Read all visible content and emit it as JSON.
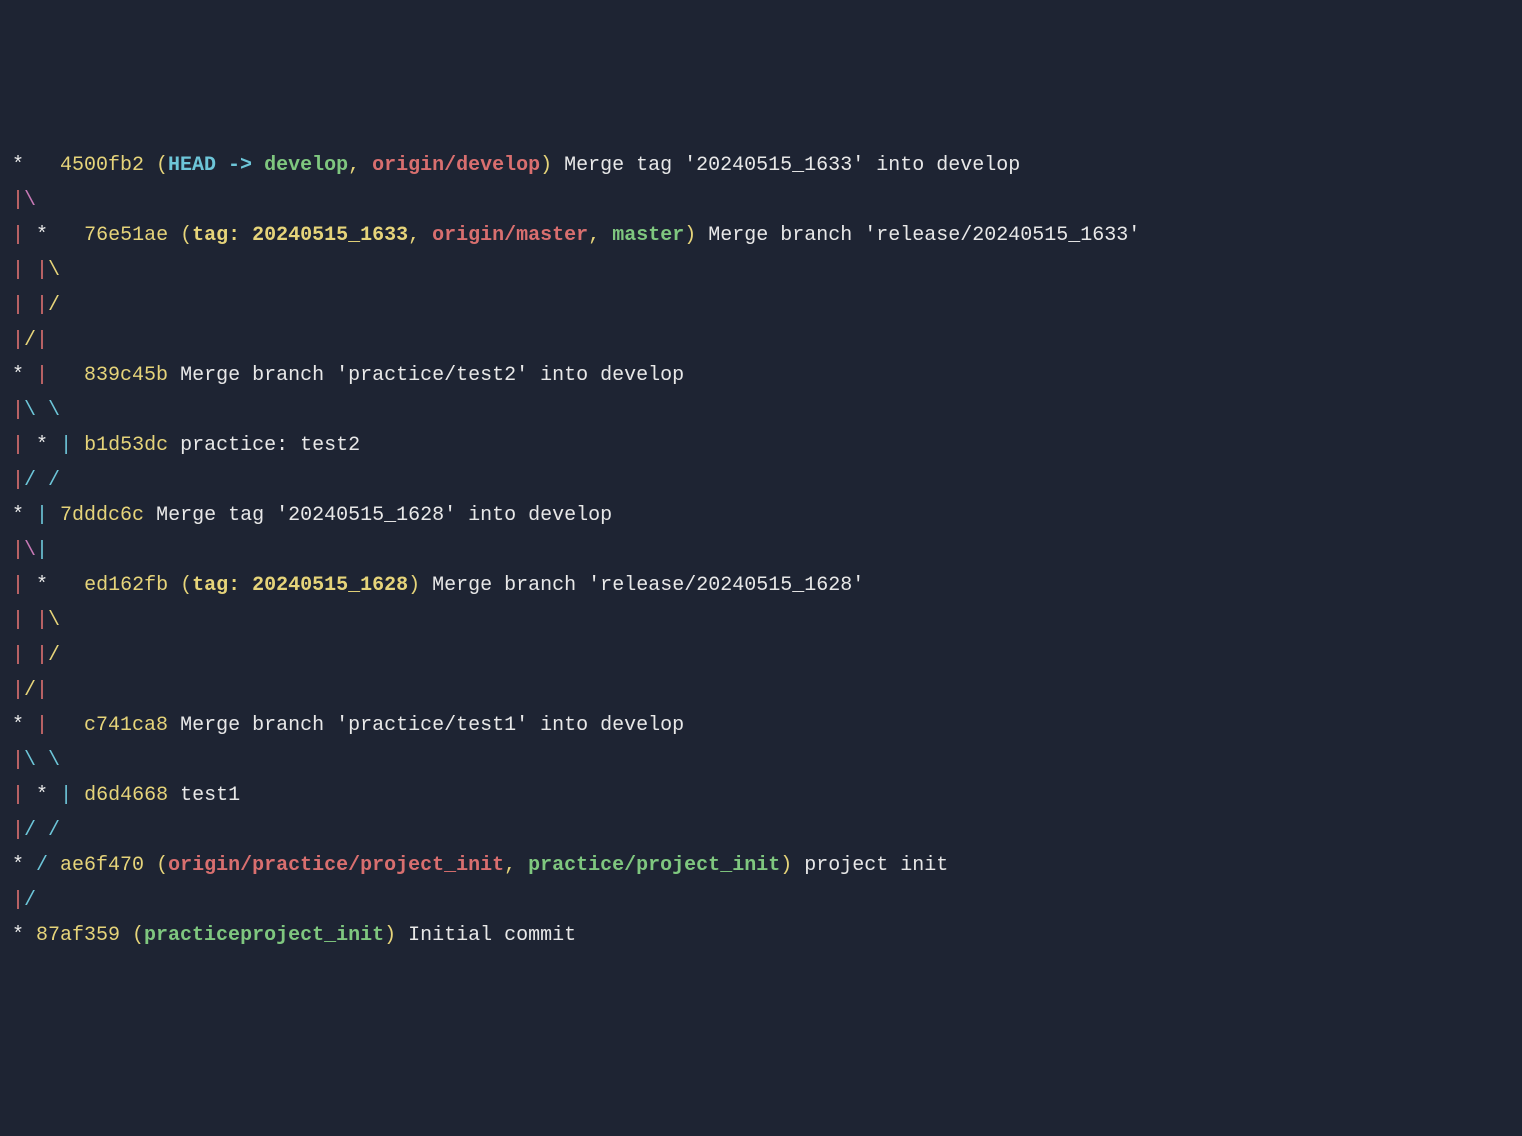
{
  "git_log": {
    "lines": [
      {
        "segments": [
          {
            "text": "*   ",
            "class": "white"
          },
          {
            "text": "4500fb2",
            "class": "yellow"
          },
          {
            "text": " (",
            "class": "yellow"
          },
          {
            "text": "HEAD -> ",
            "class": "cyan-bold"
          },
          {
            "text": "develop",
            "class": "green-bold"
          },
          {
            "text": ", ",
            "class": "yellow"
          },
          {
            "text": "origin/develop",
            "class": "red-bold"
          },
          {
            "text": ")",
            "class": "yellow"
          },
          {
            "text": " Merge tag '20240515_1633' into develop",
            "class": "white"
          }
        ]
      },
      {
        "segments": [
          {
            "text": "|",
            "class": "red"
          },
          {
            "text": "\\",
            "class": "magenta"
          }
        ]
      },
      {
        "segments": [
          {
            "text": "|",
            "class": "red"
          },
          {
            "text": " ",
            "class": "white"
          },
          {
            "text": "*",
            "class": "white"
          },
          {
            "text": "   ",
            "class": "white"
          },
          {
            "text": "76e51ae",
            "class": "yellow"
          },
          {
            "text": " (",
            "class": "yellow"
          },
          {
            "text": "tag: 20240515_1633",
            "class": "yellow-bold"
          },
          {
            "text": ", ",
            "class": "yellow"
          },
          {
            "text": "origin/master",
            "class": "red-bold"
          },
          {
            "text": ", ",
            "class": "yellow"
          },
          {
            "text": "master",
            "class": "green-bold"
          },
          {
            "text": ")",
            "class": "yellow"
          },
          {
            "text": " Merge branch 'release/20240515_1633'",
            "class": "white"
          }
        ]
      },
      {
        "segments": [
          {
            "text": "|",
            "class": "red"
          },
          {
            "text": " ",
            "class": "white"
          },
          {
            "text": "|",
            "class": "red"
          },
          {
            "text": "\\",
            "class": "yellow"
          }
        ]
      },
      {
        "segments": [
          {
            "text": "|",
            "class": "red"
          },
          {
            "text": " ",
            "class": "white"
          },
          {
            "text": "|",
            "class": "red"
          },
          {
            "text": "/",
            "class": "yellow"
          }
        ]
      },
      {
        "segments": [
          {
            "text": "|",
            "class": "red"
          },
          {
            "text": "/",
            "class": "yellow"
          },
          {
            "text": "|",
            "class": "red"
          }
        ]
      },
      {
        "segments": [
          {
            "text": "* ",
            "class": "white"
          },
          {
            "text": "|",
            "class": "red"
          },
          {
            "text": "   ",
            "class": "white"
          },
          {
            "text": "839c45b",
            "class": "yellow"
          },
          {
            "text": " Merge branch 'practice/test2' into develop",
            "class": "white"
          }
        ]
      },
      {
        "segments": [
          {
            "text": "|",
            "class": "red"
          },
          {
            "text": "\\",
            "class": "cyan"
          },
          {
            "text": " ",
            "class": "white"
          },
          {
            "text": "\\",
            "class": "cyan"
          }
        ]
      },
      {
        "segments": [
          {
            "text": "|",
            "class": "red"
          },
          {
            "text": " ",
            "class": "white"
          },
          {
            "text": "*",
            "class": "white"
          },
          {
            "text": " ",
            "class": "white"
          },
          {
            "text": "|",
            "class": "cyan"
          },
          {
            "text": " ",
            "class": "white"
          },
          {
            "text": "b1d53dc",
            "class": "yellow"
          },
          {
            "text": " practice: test2",
            "class": "white"
          }
        ]
      },
      {
        "segments": [
          {
            "text": "|",
            "class": "red"
          },
          {
            "text": "/",
            "class": "cyan"
          },
          {
            "text": " ",
            "class": "white"
          },
          {
            "text": "/",
            "class": "cyan"
          }
        ]
      },
      {
        "segments": [
          {
            "text": "* ",
            "class": "white"
          },
          {
            "text": "|",
            "class": "cyan"
          },
          {
            "text": " ",
            "class": "white"
          },
          {
            "text": "7dddc6c",
            "class": "yellow"
          },
          {
            "text": " Merge tag '20240515_1628' into develop",
            "class": "white"
          }
        ]
      },
      {
        "segments": [
          {
            "text": "|",
            "class": "red"
          },
          {
            "text": "\\",
            "class": "magenta"
          },
          {
            "text": "|",
            "class": "cyan"
          }
        ]
      },
      {
        "segments": [
          {
            "text": "|",
            "class": "red"
          },
          {
            "text": " ",
            "class": "white"
          },
          {
            "text": "*",
            "class": "white"
          },
          {
            "text": "   ",
            "class": "white"
          },
          {
            "text": "ed162fb",
            "class": "yellow"
          },
          {
            "text": " (",
            "class": "yellow"
          },
          {
            "text": "tag: 20240515_1628",
            "class": "yellow-bold"
          },
          {
            "text": ")",
            "class": "yellow"
          },
          {
            "text": " Merge branch 'release/20240515_1628'",
            "class": "white"
          }
        ]
      },
      {
        "segments": [
          {
            "text": "|",
            "class": "red"
          },
          {
            "text": " ",
            "class": "white"
          },
          {
            "text": "|",
            "class": "red"
          },
          {
            "text": "\\",
            "class": "yellow"
          }
        ]
      },
      {
        "segments": [
          {
            "text": "|",
            "class": "red"
          },
          {
            "text": " ",
            "class": "white"
          },
          {
            "text": "|",
            "class": "red"
          },
          {
            "text": "/",
            "class": "yellow"
          }
        ]
      },
      {
        "segments": [
          {
            "text": "|",
            "class": "red"
          },
          {
            "text": "/",
            "class": "yellow"
          },
          {
            "text": "|",
            "class": "red"
          }
        ]
      },
      {
        "segments": [
          {
            "text": "* ",
            "class": "white"
          },
          {
            "text": "|",
            "class": "red"
          },
          {
            "text": "   ",
            "class": "white"
          },
          {
            "text": "c741ca8",
            "class": "yellow"
          },
          {
            "text": " Merge branch 'practice/test1' into develop",
            "class": "white"
          }
        ]
      },
      {
        "segments": [
          {
            "text": "|",
            "class": "red"
          },
          {
            "text": "\\",
            "class": "cyan"
          },
          {
            "text": " ",
            "class": "white"
          },
          {
            "text": "\\",
            "class": "cyan"
          }
        ]
      },
      {
        "segments": [
          {
            "text": "|",
            "class": "red"
          },
          {
            "text": " ",
            "class": "white"
          },
          {
            "text": "*",
            "class": "white"
          },
          {
            "text": " ",
            "class": "white"
          },
          {
            "text": "|",
            "class": "cyan"
          },
          {
            "text": " ",
            "class": "white"
          },
          {
            "text": "d6d4668",
            "class": "yellow"
          },
          {
            "text": " test1",
            "class": "white"
          }
        ]
      },
      {
        "segments": [
          {
            "text": "|",
            "class": "red"
          },
          {
            "text": "/",
            "class": "cyan"
          },
          {
            "text": " ",
            "class": "white"
          },
          {
            "text": "/",
            "class": "cyan"
          }
        ]
      },
      {
        "segments": [
          {
            "text": "* ",
            "class": "white"
          },
          {
            "text": "/",
            "class": "cyan"
          },
          {
            "text": " ",
            "class": "white"
          },
          {
            "text": "ae6f470",
            "class": "yellow"
          },
          {
            "text": " (",
            "class": "yellow"
          },
          {
            "text": "origin/practice/project_init",
            "class": "red-bold"
          },
          {
            "text": ", ",
            "class": "yellow"
          },
          {
            "text": "practice/project_init",
            "class": "green-bold"
          },
          {
            "text": ")",
            "class": "yellow"
          },
          {
            "text": " project init",
            "class": "white"
          }
        ]
      },
      {
        "segments": [
          {
            "text": "|",
            "class": "red"
          },
          {
            "text": "/",
            "class": "cyan"
          }
        ]
      },
      {
        "segments": [
          {
            "text": "* ",
            "class": "white"
          },
          {
            "text": "87af359",
            "class": "yellow"
          },
          {
            "text": " (",
            "class": "yellow"
          },
          {
            "text": "practiceproject_init",
            "class": "green-bold"
          },
          {
            "text": ")",
            "class": "yellow"
          },
          {
            "text": " Initial commit",
            "class": "white"
          }
        ]
      }
    ]
  }
}
